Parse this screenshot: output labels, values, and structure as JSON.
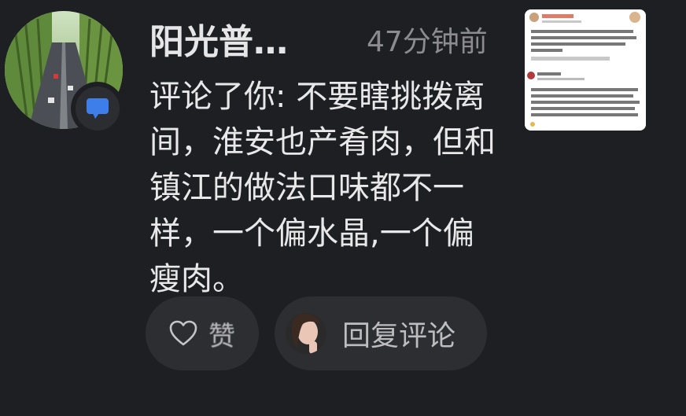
{
  "notification": {
    "username": "阳光普…",
    "time": "47分钟前",
    "comment": "评论了你: 不要瞎挑拨离间，淮安也产肴肉，但和镇江的做法口味都不一样，一个偏水晶,一个偏瘦肉。"
  },
  "actions": {
    "like_label": "赞",
    "reply_label": "回复评论"
  },
  "colors": {
    "background": "#1e1f22",
    "button_bg": "#2d2e32",
    "badge_icon": "#3d7eea",
    "muted_text": "#8c8c90"
  },
  "icons": {
    "badge": "comment-bubble-icon",
    "like": "heart-icon"
  }
}
